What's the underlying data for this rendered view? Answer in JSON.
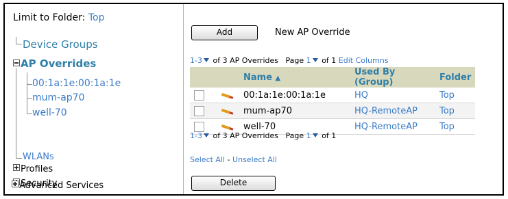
{
  "limit": {
    "label": "Limit to Folder:",
    "folder": "Top"
  },
  "tree": {
    "device_groups": "Device Groups",
    "ap_overrides": "AP Overrides",
    "children": [
      "00:1a:1e:00:1a:1e",
      "mum-ap70",
      "well-70"
    ],
    "wlans": "WLANs",
    "profiles": "Profiles",
    "security": "Security",
    "advanced": "Advanced Services"
  },
  "toolbar": {
    "add_label": "Add",
    "new_override_label": "New AP Override",
    "delete_label": "Delete"
  },
  "pager_top": {
    "range": "1-3",
    "of_text": "of 3 AP Overrides",
    "page_label": "Page",
    "page_num": "1",
    "of_pages": "of 1",
    "edit_columns": "Edit Columns"
  },
  "pager_bottom": {
    "range": "1-3",
    "of_text": "of 3 AP Overrides",
    "page_label": "Page",
    "page_num": "1",
    "of_pages": "of 1"
  },
  "table": {
    "headers": {
      "name": "Name",
      "used_by": "Used By (Group)",
      "folder": "Folder"
    },
    "rows": [
      {
        "name": "00:1a:1e:00:1a:1e",
        "used_by": "HQ",
        "folder": "Top"
      },
      {
        "name": "mum-ap70",
        "used_by": "HQ-RemoteAP",
        "folder": "Top"
      },
      {
        "name": "well-70",
        "used_by": "HQ-RemoteAP",
        "folder": "Top"
      }
    ]
  },
  "selection": {
    "select_all": "Select All",
    "separator": " - ",
    "unselect_all": "Unselect All"
  },
  "colors": {
    "link": "#3a7bc8",
    "tree_teal": "#2f7fa8",
    "header_bg": "#d8d8bd"
  }
}
